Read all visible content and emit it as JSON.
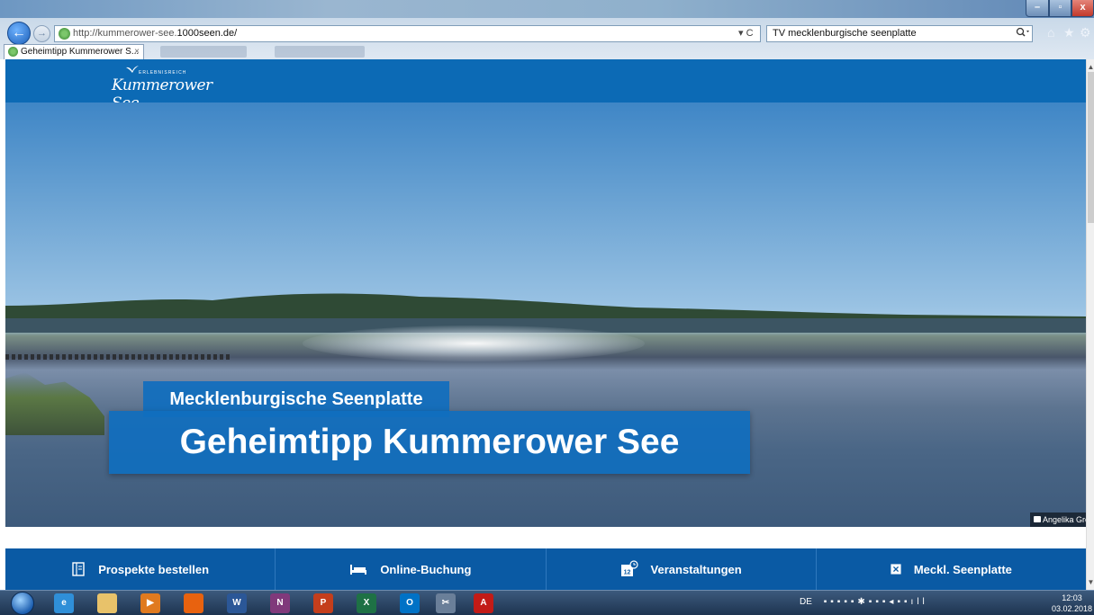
{
  "browser": {
    "url_prefix": "http://kummerower-see.",
    "url_domain": "1000seen.de/",
    "address_controls": "▾ C",
    "search_query": "TV mecklenburgische seenplatte",
    "search_icon": "search-icon",
    "tab_title": "Geheimtipp Kummerower S...",
    "tab_close": "×",
    "window_min": "–",
    "window_max": "▫",
    "window_close": "x",
    "back_arrow": "←",
    "forward_arrow": "→",
    "home_icon": "⌂",
    "favorites_icon": "★",
    "tools_icon": "⚙"
  },
  "header": {
    "logo_small": "ERLEBNISREICH",
    "logo_main": "Kummerower See"
  },
  "hero": {
    "subtitle": "Mecklenburgische Seenplatte",
    "title": "Geheimtipp Kummerower See",
    "photo_credit": "Angelika Groh"
  },
  "quicknav": [
    {
      "label": "Prospekte bestellen",
      "icon": "brochure-icon"
    },
    {
      "label": "Online-Buchung",
      "icon": "bed-icon"
    },
    {
      "label": "Veranstaltungen",
      "icon": "calendar-icon",
      "day": "12"
    },
    {
      "label": "Meckl. Seenplatte",
      "icon": "close-box-icon"
    }
  ],
  "taskbar": {
    "apps": [
      {
        "name": "internet-explorer",
        "label": "e",
        "color": "#2f8fd8"
      },
      {
        "name": "file-explorer",
        "label": "",
        "color": "#e8c26a"
      },
      {
        "name": "media-player",
        "label": "▶",
        "color": "#e07a1f"
      },
      {
        "name": "firefox",
        "label": "",
        "color": "#e8620f"
      },
      {
        "name": "word",
        "label": "W",
        "color": "#2b5797"
      },
      {
        "name": "onenote",
        "label": "N",
        "color": "#80397b"
      },
      {
        "name": "powerpoint",
        "label": "P",
        "color": "#c43e1c"
      },
      {
        "name": "excel",
        "label": "X",
        "color": "#1e7145"
      },
      {
        "name": "outlook",
        "label": "O",
        "color": "#0072c6"
      },
      {
        "name": "snipping-tool",
        "label": "✂",
        "color": "#6a7f99"
      },
      {
        "name": "acrobat",
        "label": "A",
        "color": "#c21b17"
      }
    ],
    "language": "DE",
    "time": "12:03",
    "date": "03.02.2018"
  }
}
